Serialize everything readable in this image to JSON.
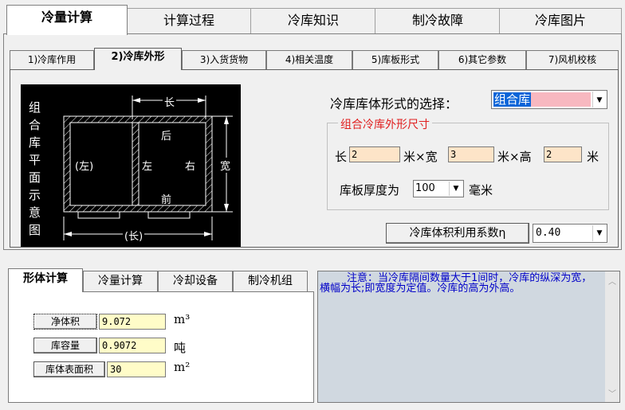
{
  "top_tabs": [
    "冷量计算",
    "计算过程",
    "冷库知识",
    "制冷故障",
    "冷库图片"
  ],
  "sub_tabs": [
    "1)冷库作用",
    "2)冷库外形",
    "3)入货货物",
    "4)相关温度",
    "5)库板形式",
    "6)其它参数",
    "7)风机校核"
  ],
  "diagram": {
    "vertical_text": [
      "组",
      "合",
      "库",
      "平",
      "面",
      "示",
      "意",
      "图"
    ],
    "top_length": "长",
    "bottom_length": "(长)",
    "width_label": "宽",
    "left_room": "(左)",
    "left_label": "左",
    "right_label": "右",
    "back_label": "后",
    "front_label": "前"
  },
  "form": {
    "type_label": "冷库库体形式的选择：",
    "type_value": "组合库",
    "group_title": "组合冷库外形尺寸",
    "length_label": "长",
    "length_value": "2",
    "width_label": "米×宽",
    "width_value": "3",
    "height_label": "米×高",
    "height_value": "2",
    "unit_m": "米",
    "thickness_label": "库板厚度为",
    "thickness_value": "100",
    "thickness_unit": "毫米",
    "coef_button": "冷库体积利用系数η",
    "coef_value": "0.40"
  },
  "bottom_tabs": [
    "形体计算",
    "冷量计算",
    "冷却设备",
    "制冷机组"
  ],
  "calc": {
    "net_volume_btn": "净体积",
    "net_volume_value": "9.072",
    "net_volume_unit": "m³",
    "capacity_btn": "库容量",
    "capacity_value": "0.9072",
    "capacity_unit": "吨",
    "surface_btn": "库体表面积",
    "surface_value": "30",
    "surface_unit": "m²"
  },
  "note": "注意：当冷库隔间数量大于1间时，冷库的纵深为宽，横幅为长;即宽度为定值。冷库的高为外高。"
}
